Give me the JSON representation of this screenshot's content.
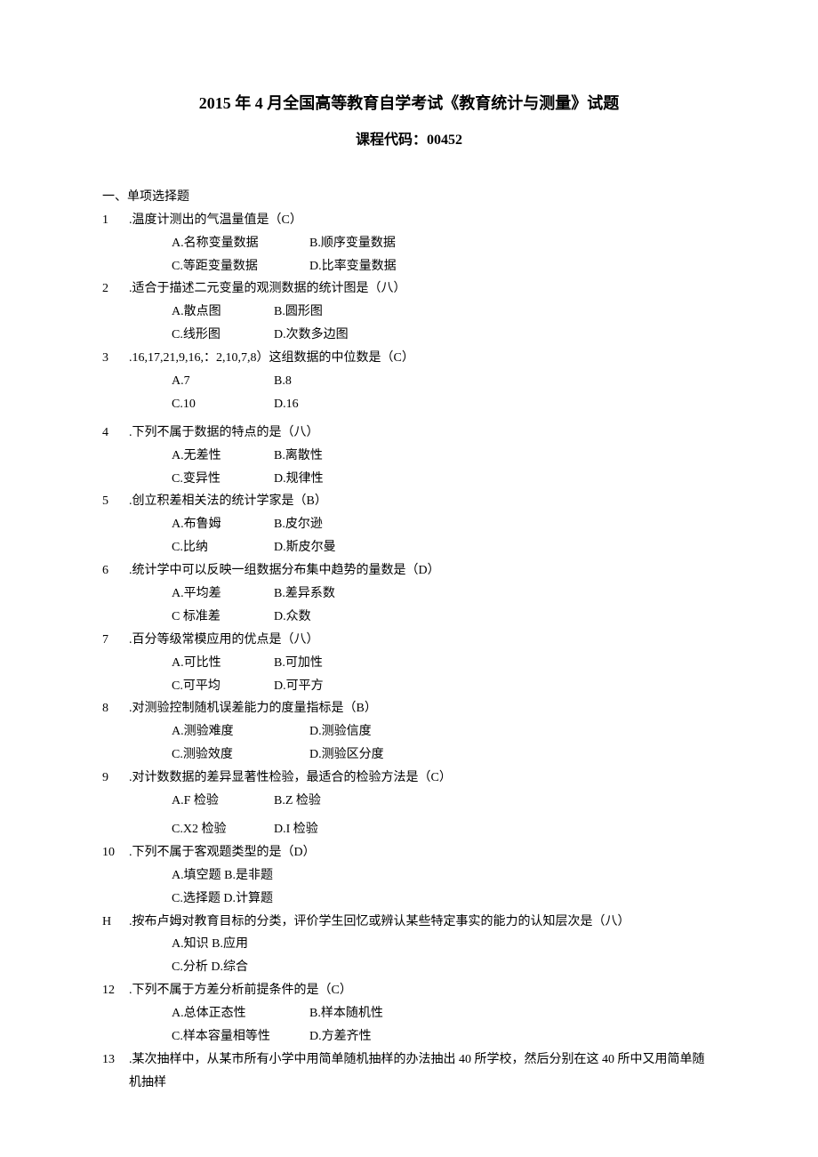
{
  "title": "2015 年 4 月全国高等教育自学考试《教育统计与测量》试题",
  "subtitle": "课程代码：00452",
  "sectionHead": "一、单项选择题",
  "questions": [
    {
      "n": "1",
      "stem": ".温度计测出的气温量值是（C）",
      "opts": [
        "A.名称变量数据",
        "B.顺序变量数据",
        "C.等距变量数据",
        "D.比率变量数据"
      ],
      "w": "w-mid"
    },
    {
      "n": "2",
      "stem": ".适合于描述二元变量的观测数据的统计图是（八）",
      "opts": [
        "A.散点图",
        "B.圆形图",
        "C.线形图",
        "D.次数多边图"
      ],
      "w": "w-narrow"
    },
    {
      "n": "3",
      "stem": ".16,17,21,9,16,：2,10,7,8）这组数据的中位数是（C）",
      "opts": [
        "A.7",
        "B.8",
        "C.10",
        "D.16"
      ],
      "w": "w-narrow",
      "gapAfter": true
    },
    {
      "n": "4",
      "stem": ".下列不属于数据的特点的是（八）",
      "opts": [
        "A.无差性",
        "B.离散性",
        "C.变异性",
        "D.规律性"
      ],
      "w": "w-narrow"
    },
    {
      "n": "5",
      "stem": ".创立积差相关法的统计学家是（B）",
      "opts": [
        "A.布鲁姆",
        "B.皮尔逊",
        "C.比纳",
        "D.斯皮尔曼"
      ],
      "w": "w-narrow"
    },
    {
      "n": "6",
      "stem": ".统计学中可以反映一组数据分布集中趋势的量数是（D）",
      "opts": [
        "A.平均差",
        "B.差异系数",
        "C 标准差",
        "D.众数"
      ],
      "w": "w-narrow"
    },
    {
      "n": "7",
      "stem": ".百分等级常模应用的优点是（八）",
      "opts": [
        "A.可比性",
        "B.可加性",
        "C.可平均",
        "D.可平方"
      ],
      "w": "w-narrow"
    },
    {
      "n": "8",
      "stem": ".对测验控制随机误差能力的度量指标是（B）",
      "opts": [
        "A.测验难度",
        "D.测验信度",
        "C.测验效度",
        "D.测验区分度"
      ],
      "w": "w-mid"
    },
    {
      "n": "9",
      "stem": ".对计数数据的差异显著性检验，最适合的检验方法是（C）",
      "opts": [
        "A.F 检验",
        "B.Z 检验",
        "C.X2 检验",
        "D.I 检验"
      ],
      "w": "w-narrow",
      "gapMid": true
    },
    {
      "n": "10",
      "stem": ".下列不属于客观题类型的是（D）",
      "opts": [
        "A.填空题 B.是非题",
        "",
        "C.选择题 D.计算题",
        ""
      ],
      "w": "w-joined"
    },
    {
      "n": "H",
      "stem": ".按布卢姆对教育目标的分类，评价学生回忆或辨认某些特定事实的能力的认知层次是（八）",
      "opts": [
        "A.知识 B.应用",
        "",
        "C.分析 D.综合",
        ""
      ],
      "w": "w-joined"
    },
    {
      "n": "12",
      "stem": ".下列不属于方差分析前提条件的是（C）",
      "opts": [
        "A.总体正态性",
        "B.样本随机性",
        "C.样本容量相等性",
        "D.方差齐性"
      ],
      "w": "w-mid"
    },
    {
      "n": "13",
      "stem": ".某次抽样中，从某市所有小学中用简单随机抽样的办法抽出 40 所学校，然后分别在这 40 所中又用简单随机抽样",
      "opts": [],
      "w": ""
    }
  ]
}
